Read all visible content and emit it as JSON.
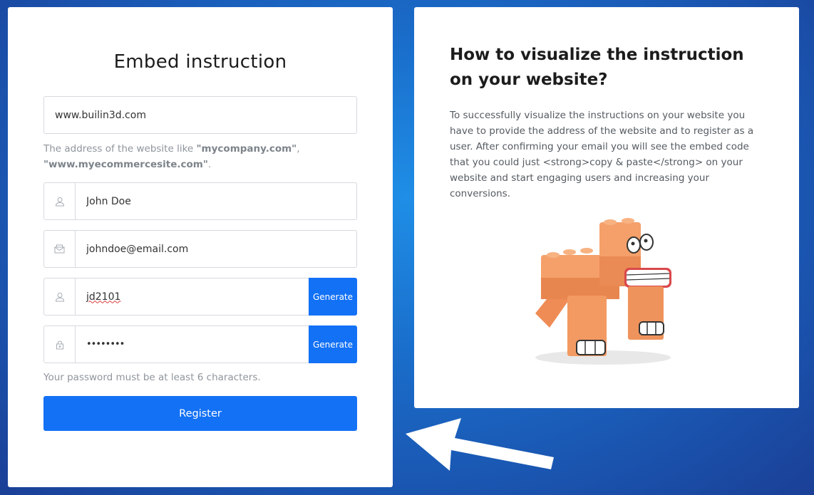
{
  "form": {
    "title": "Embed instruction",
    "website": {
      "value": "www.builin3d.com"
    },
    "website_hint": {
      "prefix": "The address of the website like ",
      "example1": "\"mycompany.com\"",
      "sep": ", ",
      "example2": "\"www.myecommercesite.com\"",
      "suffix": "."
    },
    "name": {
      "value": "John Doe",
      "icon": "user-icon"
    },
    "email": {
      "value": "johndoe@email.com",
      "icon": "envelope-icon"
    },
    "username": {
      "value": "jd2101",
      "icon": "user-icon",
      "generate_label": "Generate"
    },
    "password": {
      "value": "••••••••",
      "icon": "lock-icon",
      "generate_label": "Generate"
    },
    "password_hint": "Your password must be at least 6 characters.",
    "register_label": "Register"
  },
  "info": {
    "title": "How to visualize the instruction on your website?",
    "text": "To successfully visualize the instructions on your website you have to provide the address of the website and to register as a user. After confirming your email you will see the embed code that you could just <strong>copy & paste</strong> on your website and start engaging users and increasing your conversions."
  },
  "colors": {
    "primary": "#1371f5",
    "background": "#1a6fcc",
    "mascot": "#f4955e"
  },
  "decor": {
    "mascot_icon": "brick-dinosaur-illustration",
    "arrow_icon": "arrow-pointer-icon"
  }
}
